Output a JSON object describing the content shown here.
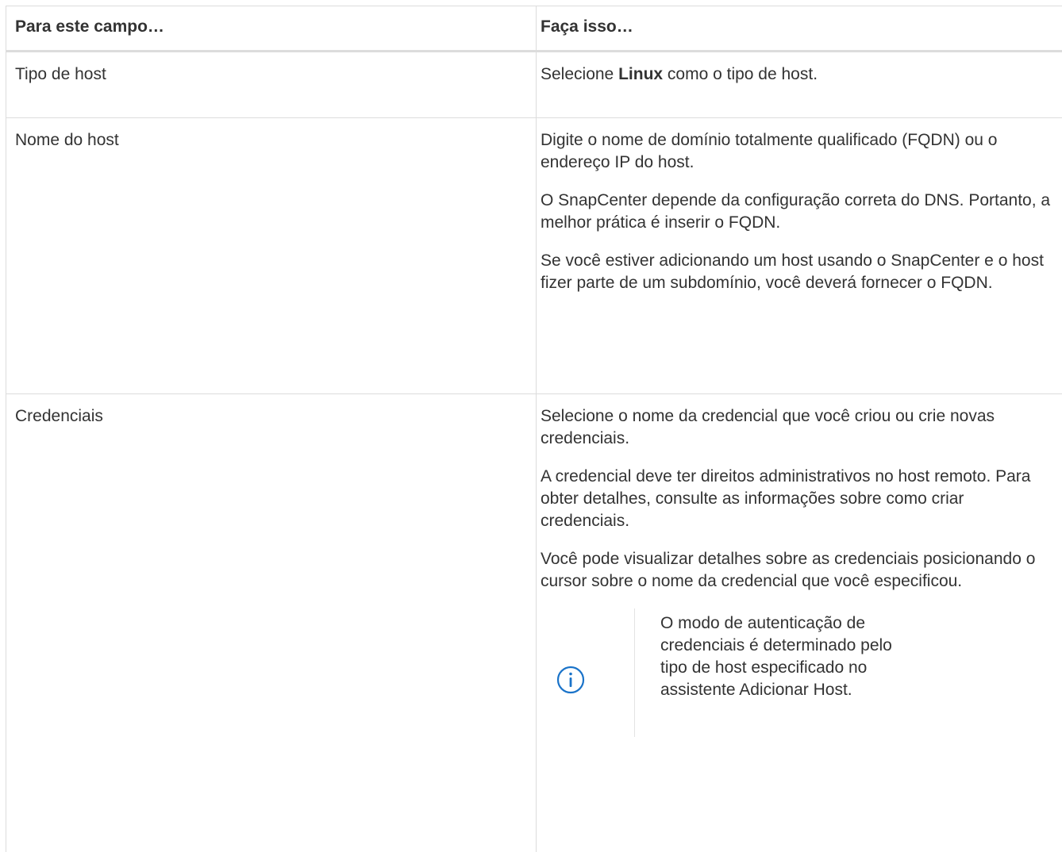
{
  "table": {
    "headers": [
      "Para este campo…",
      "Faça isso…"
    ],
    "rows": [
      {
        "field": "Tipo de host",
        "action": {
          "prefix": "Selecione ",
          "bold": "Linux",
          "suffix": " como o tipo de host."
        }
      },
      {
        "field": "Nome do host",
        "paragraphs": [
          "Digite o nome de domínio totalmente qualificado (FQDN) ou o endereço IP do host.",
          "O SnapCenter depende da configuração correta do DNS. Portanto, a melhor prática é inserir o FQDN.",
          "Se você estiver adicionando um host usando o SnapCenter e o host fizer parte de um subdomínio, você deverá fornecer o FQDN."
        ]
      },
      {
        "field": "Credenciais",
        "paragraphs": [
          "Selecione o nome da credencial que você criou ou crie novas credenciais.",
          "A credencial deve ter direitos administrativos no host remoto. Para obter detalhes, consulte as informações sobre como criar credenciais.",
          "Você pode visualizar detalhes sobre as credenciais posicionando o cursor sobre o nome da credencial que você especificou."
        ],
        "note": {
          "icon": "info-icon",
          "text": "O modo de autenticação de credenciais é determinado pelo tipo de host especificado no assistente Adicionar Host."
        }
      }
    ]
  },
  "colors": {
    "text": "#333333",
    "border": "#dcdcdc",
    "info_icon": "#1a73c9"
  }
}
